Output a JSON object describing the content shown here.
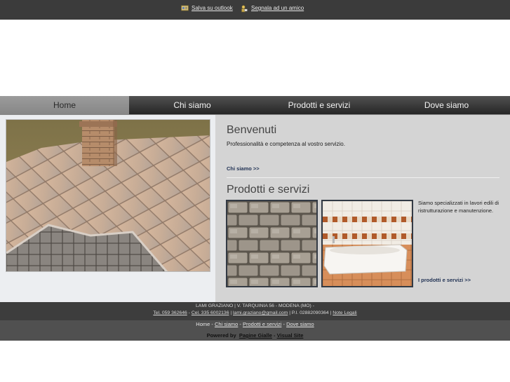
{
  "topbar": {
    "outlook_label": "Salva su outlook",
    "friend_label": "Segnala ad un amico",
    "outlook_icon": "outlook-card-icon",
    "friend_icon": "send-friend-icon"
  },
  "nav": {
    "items": [
      {
        "label": "Home",
        "active": true
      },
      {
        "label": "Chi siamo"
      },
      {
        "label": "Prodotti e servizi"
      },
      {
        "label": "Dove siamo"
      }
    ]
  },
  "welcome": {
    "title": "Benvenuti",
    "text": "Professionalità e competenza al vostro servizio.",
    "link": "Chi siamo >>"
  },
  "products": {
    "title": "Prodotti e servizi",
    "text": "Siamo specializzati in lavori edili di ristrutturazione e manutenzione.",
    "link": "I prodotti e servizi >>"
  },
  "footer": {
    "company": "LAMI GRAZIANO | V. TARQUINIA 56 - MODENA (MO) -",
    "tel": "Tel. 059 362646",
    "cel": "Cel. 335 6002136",
    "email": "lami.graziano@gmail.com",
    "piva": "P.I. 02882090364",
    "legal": "Note Legali",
    "sep": " | ",
    "dash": " - ",
    "links": [
      "Home",
      "Chi siamo",
      "Prodotti e servizi",
      "Dove siamo"
    ],
    "powered_prefix": "Powered by",
    "powered_a": "Pagine Gialle",
    "powered_b": "Visual Site"
  },
  "colors": {
    "topbar": "#3b3b3b",
    "nav_active": "#8f8f8f",
    "content_right": "#d4d4d4",
    "link": "#223355"
  }
}
